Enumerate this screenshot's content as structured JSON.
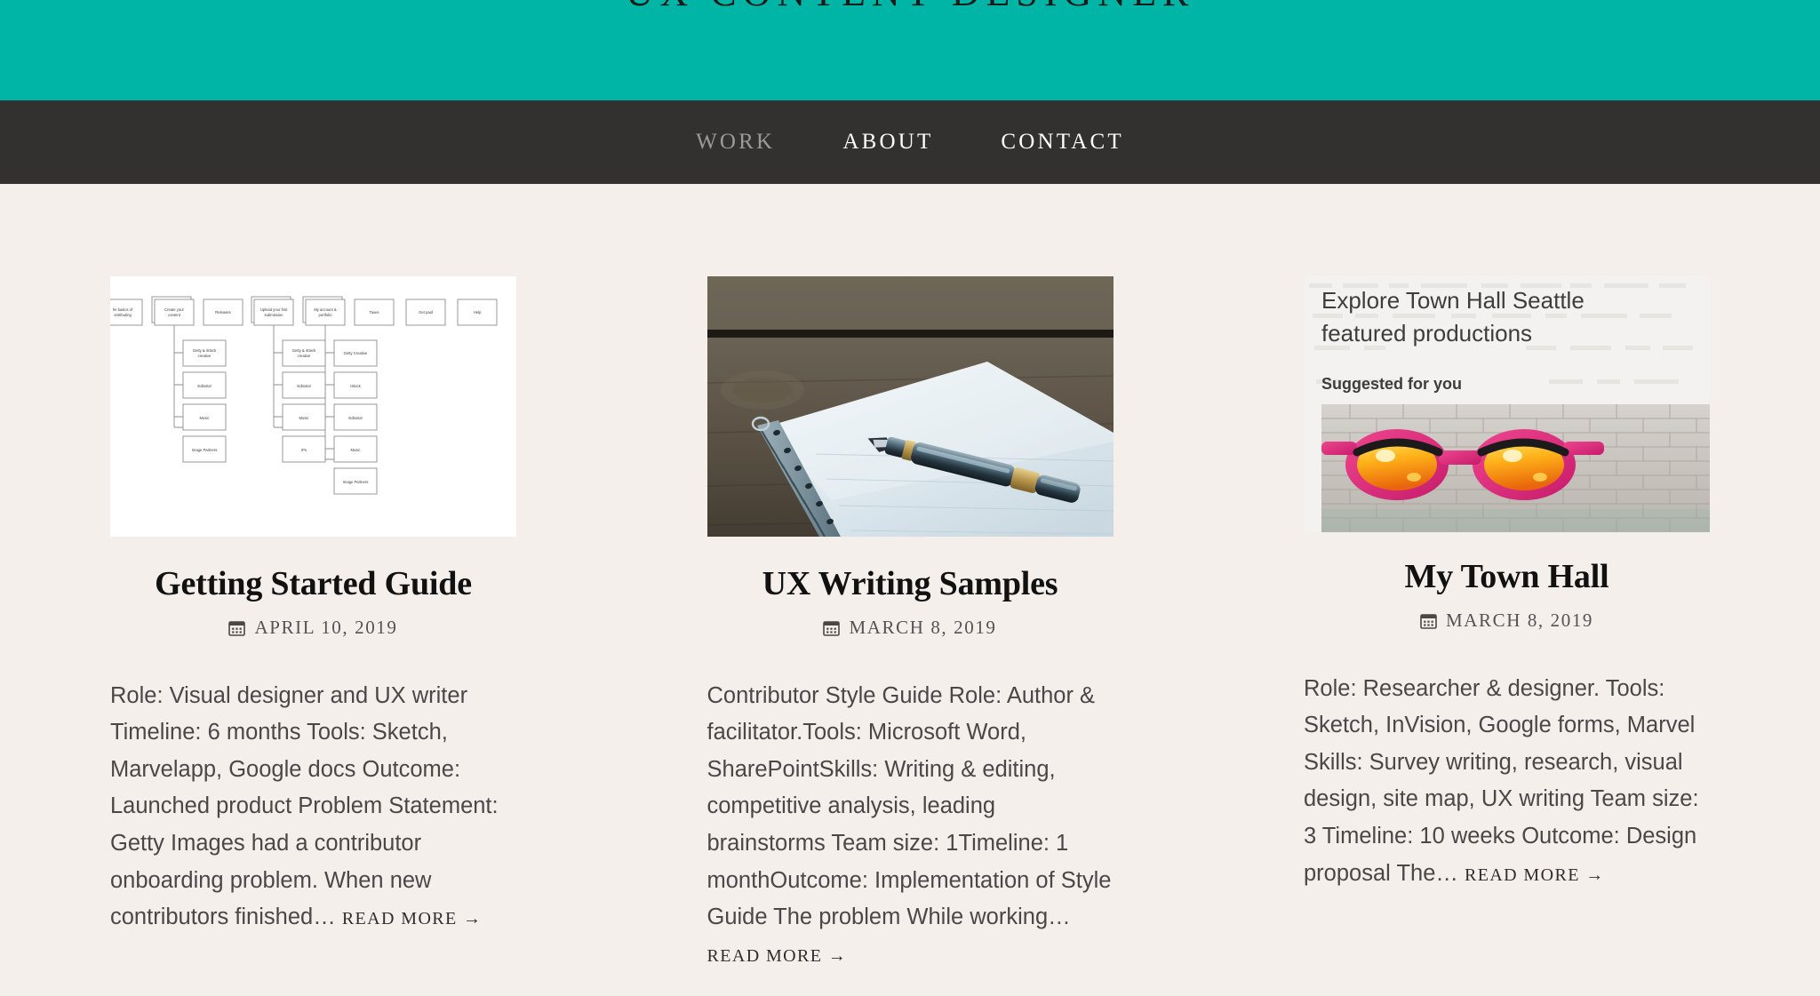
{
  "site": {
    "title": "UX CONTENT DESIGNER",
    "banner_color": "#00b5a5",
    "nav_bar_color": "#333130",
    "page_background": "#f4efeb"
  },
  "nav": {
    "items": [
      {
        "label": "WORK",
        "current": true
      },
      {
        "label": "ABOUT",
        "current": false
      },
      {
        "label": "CONTACT",
        "current": false
      }
    ]
  },
  "posts": [
    {
      "title": "Getting Started Guide",
      "date": "APRIL 10, 2019",
      "date_icon": "calendar-icon",
      "excerpt": "Role: Visual designer and UX writer Timeline: 6 months Tools: Sketch, Marvelapp, Google docs Outcome: Launched product Problem Statement: Getty Images had a contributor onboarding problem. When new contributors finished…",
      "read_more": "READ MORE →",
      "thumbnail": {
        "kind": "sitemap-diagram",
        "alt": "Site map flow diagram of contributor onboarding",
        "top_row": [
          "he basics of ontributing",
          "Create your content",
          "Releases",
          "Upload your first submission",
          "My account & portfolio",
          "Taxes",
          "Get paid",
          "Help"
        ],
        "column_a": [
          "Getty & iStock creative",
          "Editorial",
          "Music",
          "Image Partners"
        ],
        "column_b": [
          "Getty & iStock creative",
          "Editorial",
          "Music",
          "IPs"
        ],
        "column_c": [
          "Getty Creative",
          "iStock",
          "Editorial",
          "Music",
          "Image Partners"
        ]
      }
    },
    {
      "title": "UX Writing Samples",
      "date": "MARCH 8, 2019",
      "date_icon": "calendar-icon",
      "excerpt": "Contributor Style Guide Role: Author & facilitator.Tools: Microsoft Word, SharePointSkills: Writing & editing, competitive analysis, leading brainstorms Team size: 1Timeline: 1 monthOutcome: Implementation of Style Guide The problem While working…",
      "read_more": "READ MORE →",
      "thumbnail": {
        "kind": "photo-notebook-pen",
        "alt": "Fountain pen resting on a spiral notebook on a wooden table"
      }
    },
    {
      "title": "My Town Hall",
      "date": "MARCH 8, 2019",
      "date_icon": "calendar-icon",
      "excerpt": "Role: Researcher & designer. Tools: Sketch, InVision, Google forms, Marvel Skills: Survey writing, research, visual design, site map, UX writing Team size: 3 Timeline: 10 weeks Outcome: Design proposal The…",
      "read_more": "READ MORE →",
      "thumbnail": {
        "kind": "townhall-mockup",
        "alt": "Town Hall Seattle page mockup with graffiti sunglasses photo",
        "heading": "Explore Town Hall Seattle featured productions",
        "subheading": "Suggested for you"
      }
    }
  ]
}
